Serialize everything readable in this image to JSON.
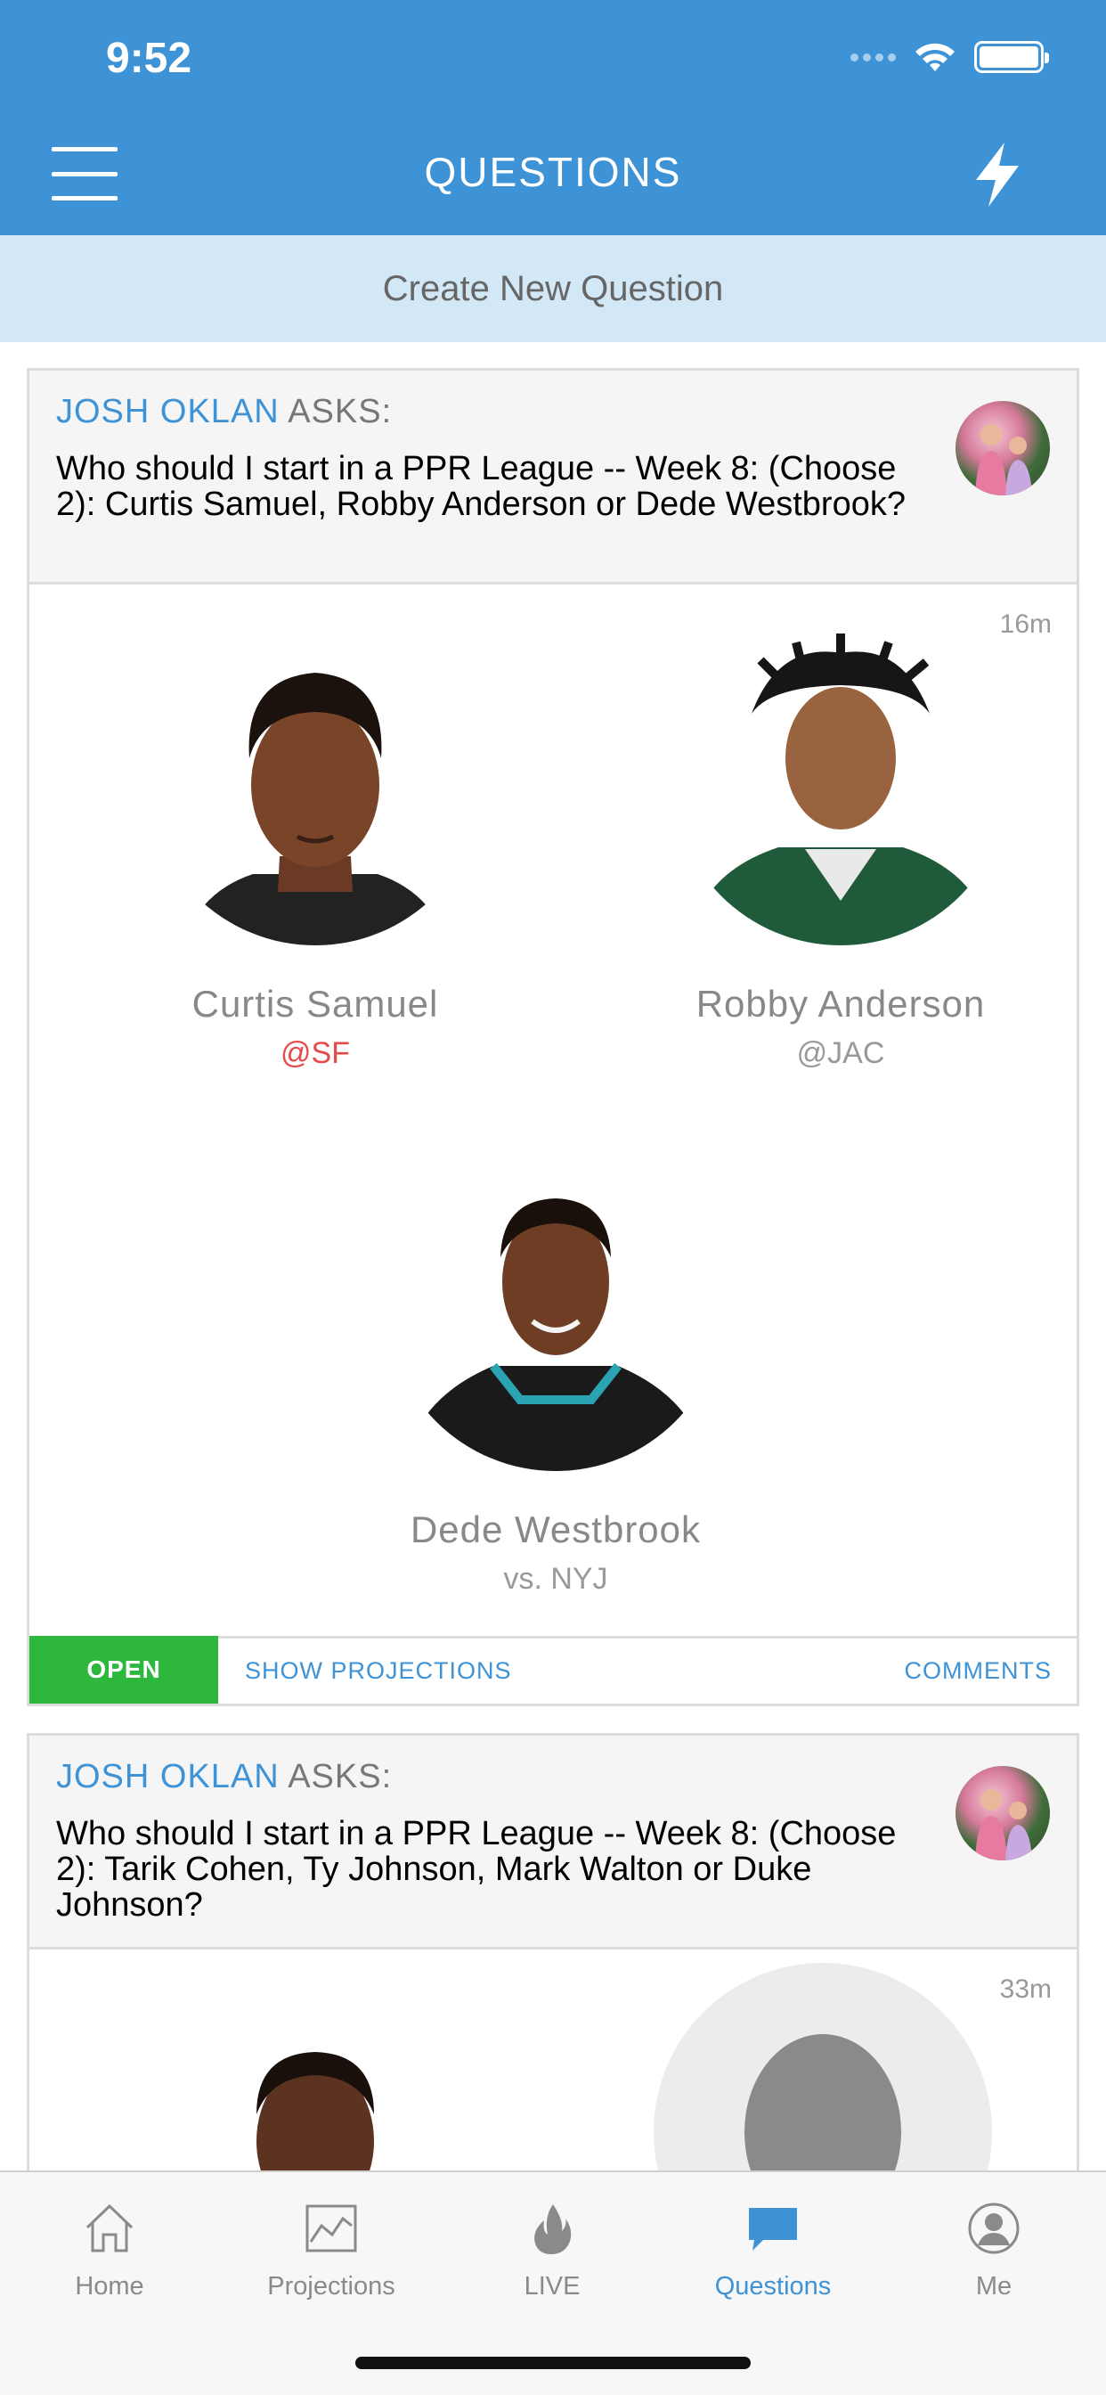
{
  "status_bar": {
    "time": "9:52"
  },
  "header": {
    "title": "QUESTIONS"
  },
  "create_question_label": "Create New Question",
  "questions": [
    {
      "asker_name": "JOSH OKLAN",
      "asks_label": "ASKS:",
      "text": "Who should I start in a PPR League -- Week 8: (Choose 2): Curtis Samuel, Robby Anderson or Dede Westbrook?",
      "time_ago": "16m",
      "players": [
        {
          "name": "Curtis Samuel",
          "opponent": "@SF",
          "opponent_color": "#e64a4a"
        },
        {
          "name": "Robby Anderson",
          "opponent": "@JAC"
        },
        {
          "name": "Dede Westbrook",
          "opponent": "vs. NYJ"
        }
      ],
      "status": "OPEN",
      "show_projections_label": "SHOW PROJECTIONS",
      "comments_label": "COMMENTS"
    },
    {
      "asker_name": "JOSH OKLAN",
      "asks_label": "ASKS:",
      "text": "Who should I start in a PPR League -- Week 8: (Choose 2): Tarik Cohen, Ty Johnson, Mark Walton or Duke Johnson?",
      "time_ago": "33m"
    }
  ],
  "tabs": [
    {
      "label": "Home",
      "icon": "home-icon"
    },
    {
      "label": "Projections",
      "icon": "chart-icon"
    },
    {
      "label": "LIVE",
      "icon": "flame-icon"
    },
    {
      "label": "Questions",
      "icon": "chat-bubble-icon",
      "active": true
    },
    {
      "label": "Me",
      "icon": "profile-icon"
    }
  ],
  "colors": {
    "brand_blue": "#3d93d6",
    "open_green": "#2db83d",
    "create_bar_bg": "#d3e8f7"
  }
}
